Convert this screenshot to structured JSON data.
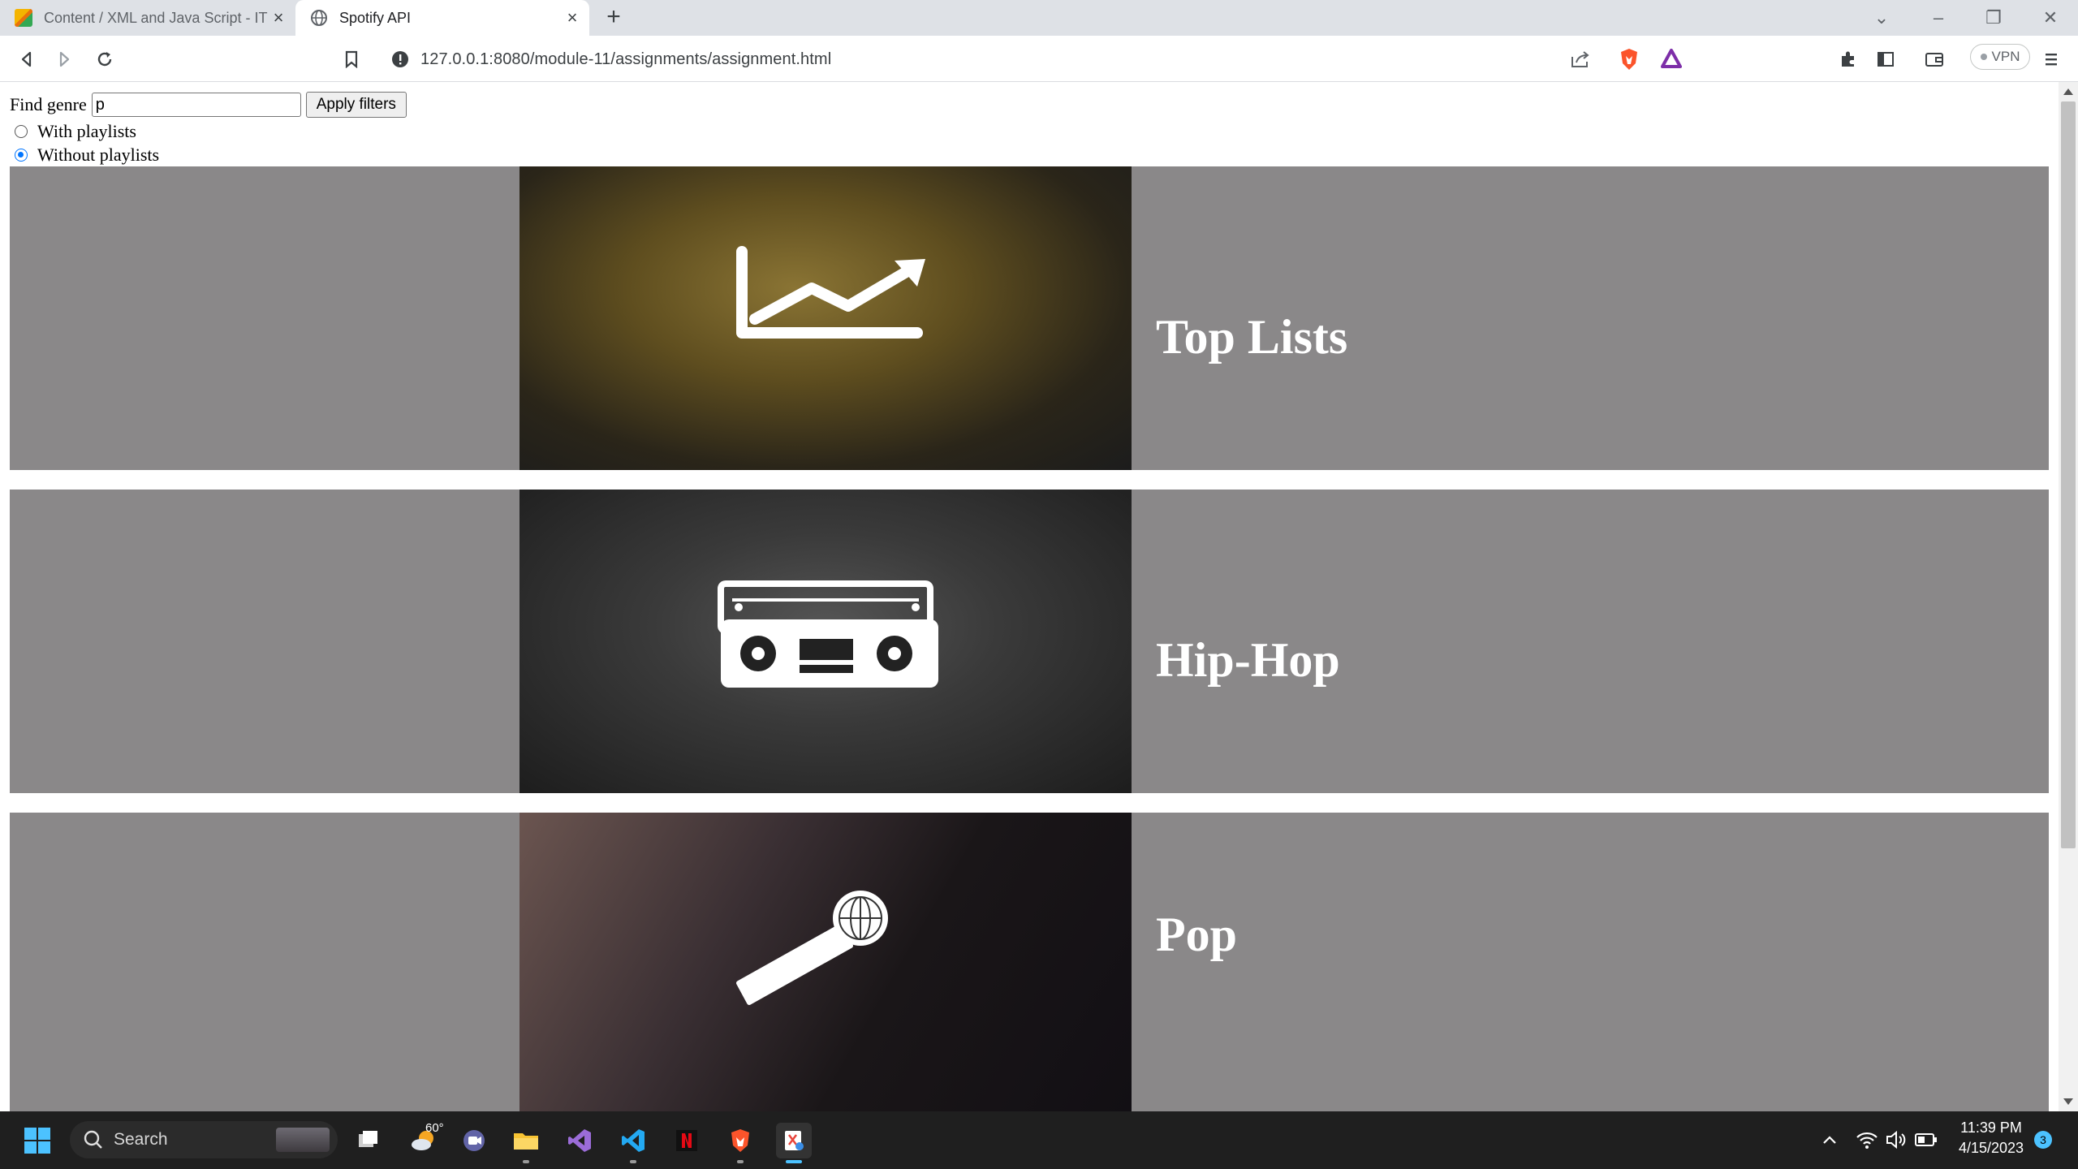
{
  "browser": {
    "tabs": [
      {
        "title": "Content / XML and Java Script - IT",
        "active": false
      },
      {
        "title": "Spotify API",
        "active": true
      }
    ],
    "url": "127.0.0.1:8080/module-11/assignments/assignment.html",
    "vpn_label": "VPN"
  },
  "page": {
    "find_genre_label": "Find genre",
    "find_genre_value": "p",
    "apply_button": "Apply filters",
    "options": [
      {
        "label": "With playlists",
        "checked": false
      },
      {
        "label": "Without playlists",
        "checked": true
      }
    ],
    "genres": [
      {
        "name": "Top Lists",
        "icon": "trending-chart-icon"
      },
      {
        "name": "Hip-Hop",
        "icon": "boombox-icon"
      },
      {
        "name": "Pop",
        "icon": "microphone-icon"
      }
    ]
  },
  "taskbar": {
    "search_label": "Search",
    "weather_temp": "60°",
    "time": "11:39 PM",
    "date": "4/15/2023",
    "notification_count": "3"
  }
}
